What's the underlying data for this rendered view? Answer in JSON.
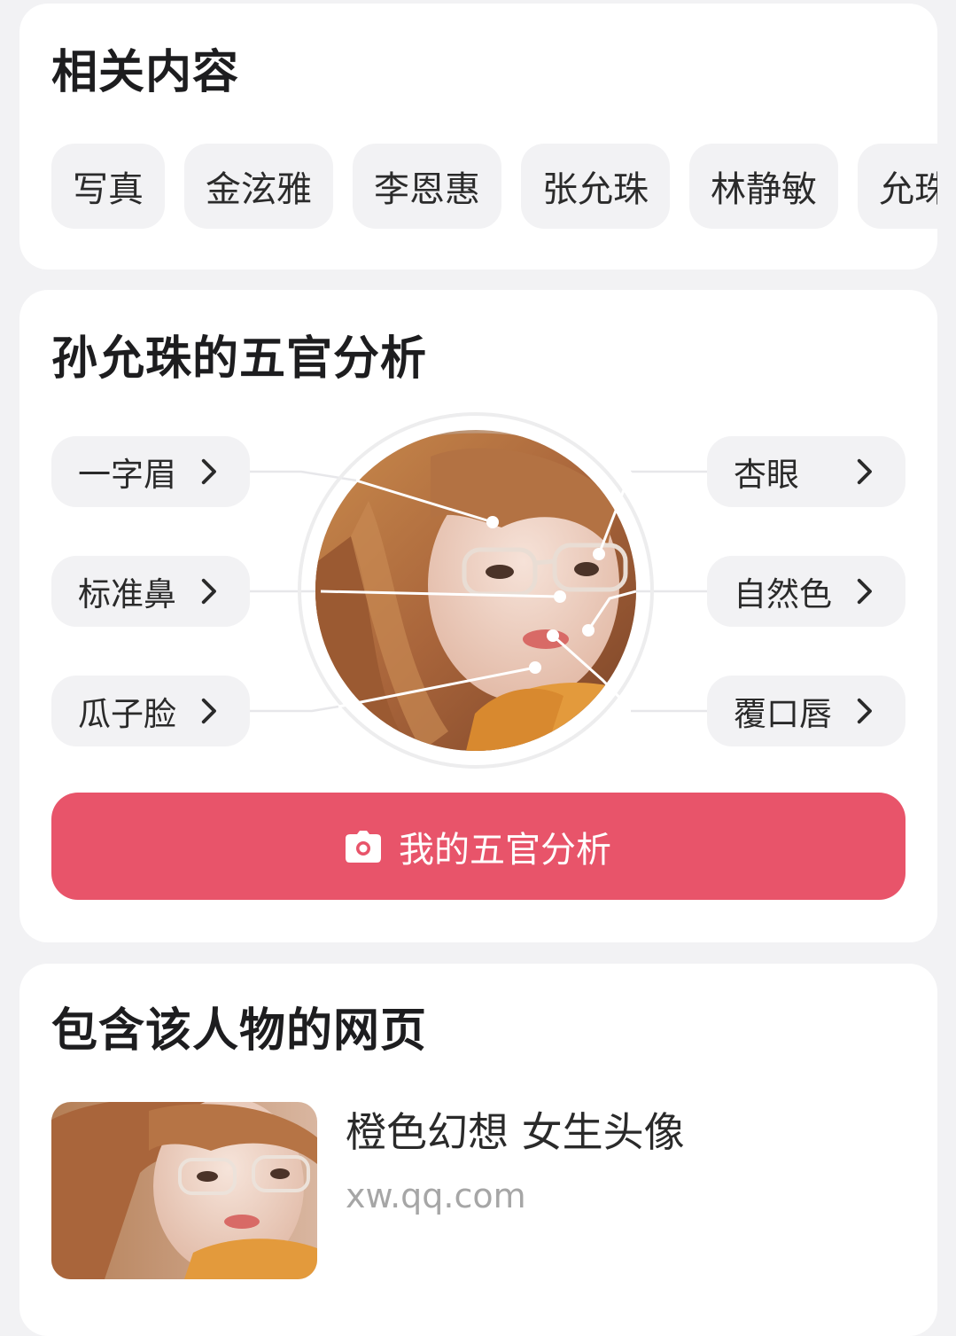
{
  "related": {
    "title": "相关内容",
    "tags": [
      "写真",
      "金泫雅",
      "李恩惠",
      "张允珠",
      "林静敏",
      "允珠"
    ]
  },
  "features": {
    "title": "孙允珠的五官分析",
    "left": [
      {
        "label": "一字眉"
      },
      {
        "label": "标准鼻"
      },
      {
        "label": "瓜子脸"
      }
    ],
    "right": [
      {
        "label": "杏眼"
      },
      {
        "label": "自然色"
      },
      {
        "label": "覆口唇"
      }
    ],
    "button_label": "我的五官分析",
    "accent": "#e8546a"
  },
  "pages": {
    "title": "包含该人物的网页",
    "items": [
      {
        "title": "橙色幻想 女生头像",
        "domain": "xw.qq.com"
      }
    ]
  }
}
